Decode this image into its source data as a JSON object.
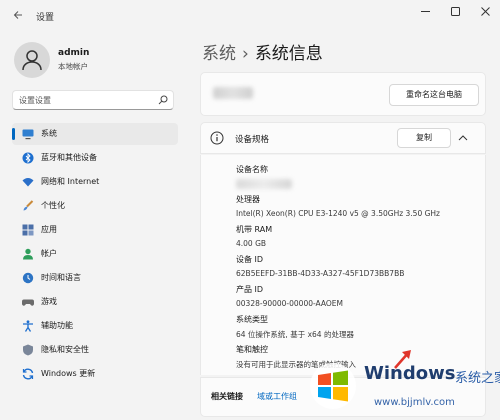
{
  "titlebar": {
    "back_icon": "arrow-left-icon",
    "title": "设置",
    "minimize_icon": "minimize-icon",
    "maximize_icon": "maximize-icon",
    "close_icon": "close-icon"
  },
  "user": {
    "name": "admin",
    "account_type": "本地帐户"
  },
  "search": {
    "placeholder": "设置设置"
  },
  "sidebar": {
    "items": [
      {
        "label": "系统",
        "icon": "monitor-icon",
        "active": true
      },
      {
        "label": "蓝牙和其他设备",
        "icon": "bluetooth-icon"
      },
      {
        "label": "网络和 Internet",
        "icon": "wifi-icon"
      },
      {
        "label": "个性化",
        "icon": "brush-icon"
      },
      {
        "label": "应用",
        "icon": "apps-icon"
      },
      {
        "label": "帐户",
        "icon": "person-icon"
      },
      {
        "label": "时间和语言",
        "icon": "globe-clock-icon"
      },
      {
        "label": "游戏",
        "icon": "gamepad-icon"
      },
      {
        "label": "辅助功能",
        "icon": "accessibility-icon"
      },
      {
        "label": "隐私和安全性",
        "icon": "shield-icon"
      },
      {
        "label": "Windows 更新",
        "icon": "sync-icon"
      }
    ]
  },
  "breadcrumb": {
    "parent": "系统",
    "separator": "›",
    "current": "系统信息"
  },
  "pc_card": {
    "rename_button": "重命名这台电脑"
  },
  "specs": {
    "title": "设备规格",
    "copy_button": "复制",
    "rows": [
      {
        "label": "设备名称",
        "value": ""
      },
      {
        "label": "处理器",
        "value": "Intel(R) Xeon(R) CPU E3-1240 v5 @ 3.50GHz   3.50 GHz"
      },
      {
        "label": "机带 RAM",
        "value": "4.00 GB"
      },
      {
        "label": "设备 ID",
        "value": "62B5EEFD-31BB-4D33-A327-45F1D73BB7BB"
      },
      {
        "label": "产品 ID",
        "value": "00328-90000-00000-AAOEM"
      },
      {
        "label": "系统类型",
        "value": "64 位操作系统, 基于 x64 的处理器"
      },
      {
        "label": "笔和触控",
        "value": "没有可用于此显示器的笔或触控输入"
      }
    ]
  },
  "related": {
    "label": "相关链接",
    "link": "域或工作组"
  },
  "watermark": {
    "title": "Windows",
    "subtitle": "系统之家",
    "url": "www.bjjmlv.com"
  },
  "colors": {
    "accent": "#0067c0",
    "background": "#f3f3f3",
    "card": "#fbfbfb"
  }
}
